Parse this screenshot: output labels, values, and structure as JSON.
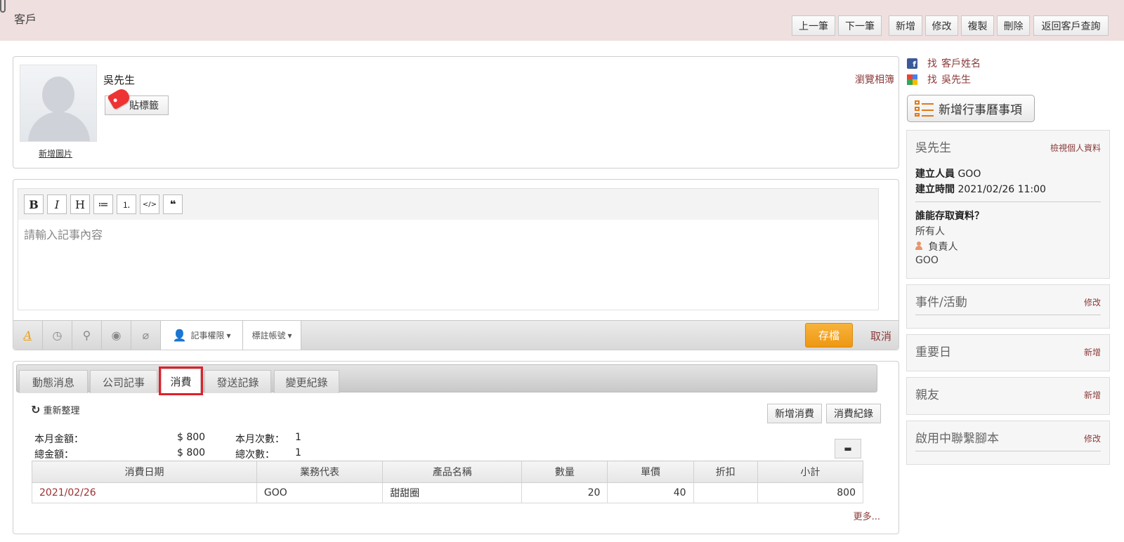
{
  "header": {
    "title": "客戶",
    "buttons": {
      "prev": "上一筆",
      "next": "下一筆",
      "add": "新增",
      "edit": "修改",
      "copy": "複製",
      "delete": "刪除",
      "back": "返回客戶查詢"
    }
  },
  "profile": {
    "name": "吳先生",
    "tag_button": "貼標籤",
    "add_photo": "新增圖片",
    "browse_album": "瀏覽相簿"
  },
  "editor": {
    "toolbar": [
      "B",
      "I",
      "H",
      "≔",
      "⒈",
      "</>",
      "❝"
    ],
    "placeholder": "請輸入記事內容",
    "permission_label": "記事權限",
    "account_label": "標註帳號",
    "save": "存檔",
    "cancel": "取消"
  },
  "tabs": {
    "items": [
      "動態消息",
      "公司記事",
      "消費",
      "發送記錄",
      "變更紀錄"
    ],
    "active": "消費"
  },
  "consumption": {
    "refresh": "重新整理",
    "add_button": "新增消費",
    "record_button": "消費紀錄",
    "month_amount_label": "本月金額：",
    "month_amount": "$ 800",
    "month_count_label": "本月次數：",
    "month_count": "1",
    "total_amount_label": "總金額：",
    "total_amount": "$ 800",
    "total_count_label": "總次數：",
    "total_count": "1",
    "columns": [
      "消費日期",
      "業務代表",
      "產品名稱",
      "數量",
      "單價",
      "折扣",
      "小計"
    ],
    "rows": [
      {
        "date": "2021/02/26",
        "rep": "GOO",
        "product": "甜甜圈",
        "qty": "20",
        "price": "40",
        "discount": "",
        "subtotal": "800"
      }
    ],
    "more": "更多..."
  },
  "sidebar": {
    "find_label": "找",
    "fb_query": "客戶姓名",
    "google_query": "吳先生",
    "add_calendar": "新增行事曆事項",
    "person_box": {
      "name": "吳先生",
      "view_link": "檢視個人資料",
      "creator_label": "建立人員",
      "creator": "GOO",
      "created_label": "建立時間",
      "created": "2021/02/26 11:00",
      "access_title": "誰能存取資料？",
      "access_all": "所有人",
      "owner_label": "負責人",
      "owner": "GOO"
    },
    "boxes": [
      {
        "title": "事件/活動",
        "action": "修改"
      },
      {
        "title": "重要日",
        "action": "新增"
      },
      {
        "title": "親友",
        "action": "新增"
      },
      {
        "title": "啟用中聯繫腳本",
        "action": "修改"
      }
    ]
  },
  "colors": {
    "header_bg": "#efdfdf",
    "link": "#8b3a3a",
    "save": "#ee9713",
    "highlight": "#e0202a"
  }
}
